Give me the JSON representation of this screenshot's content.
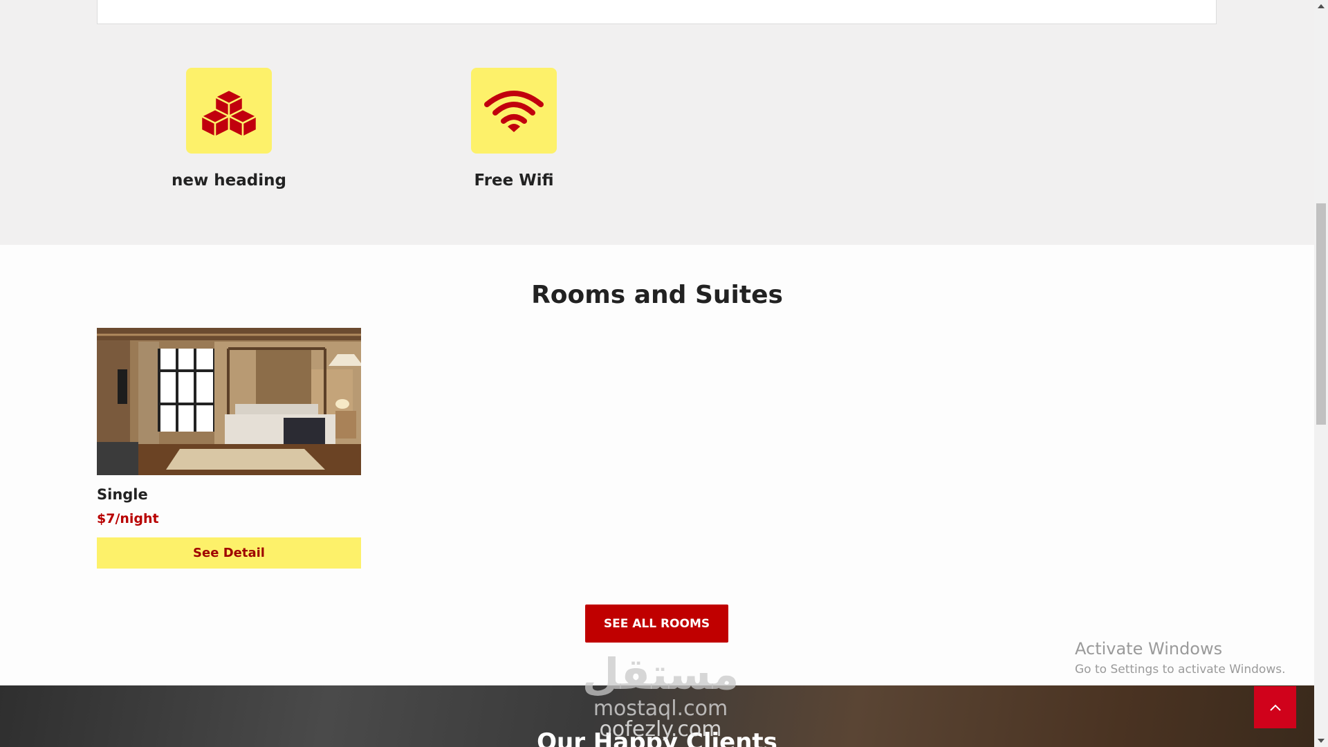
{
  "features": [
    {
      "title": "new heading",
      "icon": "boxes-icon"
    },
    {
      "title": "Free Wifi",
      "icon": "wifi-icon"
    }
  ],
  "rooms": {
    "title": "Rooms and Suites",
    "cards": [
      {
        "name": "Single",
        "price": "$7/night",
        "button": "See Detail",
        "image": "bedroom-photo"
      }
    ],
    "see_all_label": "SEE ALL ROOMS"
  },
  "clients": {
    "title": "Our Happy Clients"
  },
  "watermark": {
    "arabic": "مستقل",
    "line1": "mostaql.com",
    "line2": "oofezly.com"
  },
  "windows_notice": {
    "title": "Activate Windows",
    "subtitle": "Go to Settings to activate Windows."
  },
  "colors": {
    "accent_yellow": "#fdf16a",
    "accent_red": "#c00000",
    "icon_red": "#c1000d"
  }
}
